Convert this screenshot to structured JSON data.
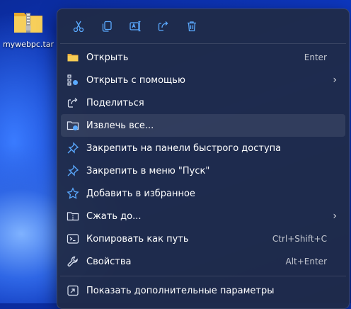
{
  "desktop": {
    "file_label": "mywebpc.tar"
  },
  "colors": {
    "accent": "#5aa9ff",
    "folder": "#f4c34a"
  },
  "toolbar": [
    {
      "name": "cut-button",
      "icon": "scissors-icon"
    },
    {
      "name": "copy-button",
      "icon": "copy-icon"
    },
    {
      "name": "rename-button",
      "icon": "rename-icon"
    },
    {
      "name": "share-button",
      "icon": "share-icon"
    },
    {
      "name": "delete-button",
      "icon": "trash-icon"
    }
  ],
  "menu": {
    "open": {
      "label": "Открыть",
      "shortcut": "Enter"
    },
    "open_with": {
      "label": "Открыть с помощью"
    },
    "share": {
      "label": "Поделиться"
    },
    "extract": {
      "label": "Извлечь все..."
    },
    "pin_quick": {
      "label": "Закрепить на панели быстрого доступа"
    },
    "pin_start": {
      "label": "Закрепить в меню \"Пуск\""
    },
    "favorites": {
      "label": "Добавить в избранное"
    },
    "compress": {
      "label": "Сжать до..."
    },
    "copy_path": {
      "label": "Копировать как путь",
      "shortcut": "Ctrl+Shift+C"
    },
    "properties": {
      "label": "Свойства",
      "shortcut": "Alt+Enter"
    },
    "more": {
      "label": "Показать дополнительные параметры"
    }
  }
}
